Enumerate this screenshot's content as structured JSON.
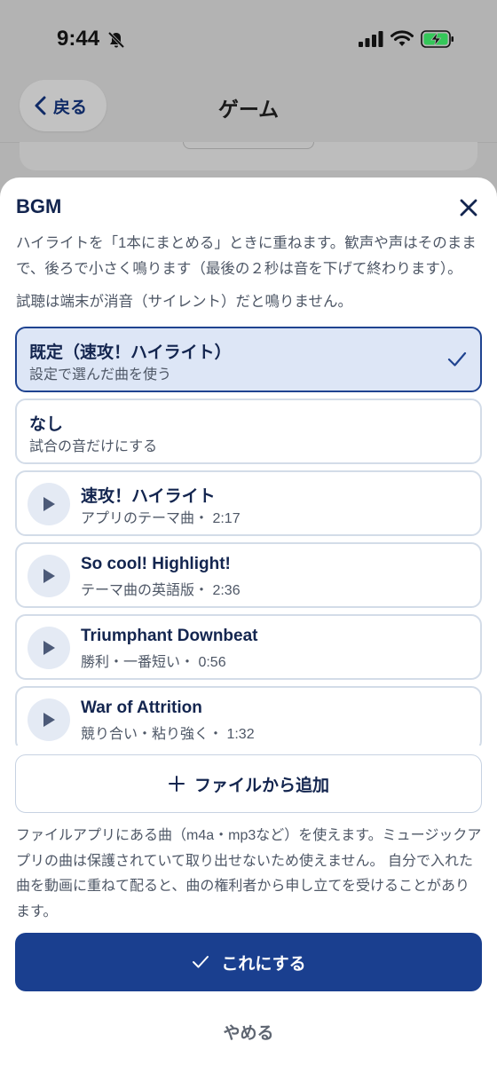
{
  "status_bar": {
    "time": "9:44"
  },
  "nav": {
    "back_label": "戻る",
    "title": "ゲーム"
  },
  "sheet": {
    "title": "BGM",
    "description": "ハイライトを「1本にまとめる」ときに重ねます。歓声や声はそのままで、後ろで小さく鳴ります（最後の２秒は音を下げて終わります）。",
    "note": "試聴は端末が消音（サイレント）だと鳴りません。",
    "options": [
      {
        "title": "既定（速攻！ハイライト）",
        "subtitle": "設定で選んだ曲を使う",
        "selected": true
      },
      {
        "title": "なし",
        "subtitle": "試合の音だけにする",
        "selected": false
      },
      {
        "title": "速攻！ハイライト",
        "subtitle": "アプリのテーマ曲・ 2:17",
        "selected": false
      },
      {
        "title": "So cool! Highlight!",
        "subtitle": "テーマ曲の英語版・ 2:36",
        "selected": false
      },
      {
        "title": "Triumphant Downbeat",
        "subtitle": "勝利・一番短い・ 0:56",
        "selected": false
      },
      {
        "title": "War of Attrition",
        "subtitle": "競り合い・粘り強く・ 1:32",
        "selected": false
      }
    ],
    "add_file_label": "ファイルから追加",
    "footnote": "ファイルアプリにある曲（m4a・mp3など）を使えます。ミュージックアプリの曲は保護されていて取り出せないため使えません。 自分で入れた曲を動画に重ねて配ると、曲の権利者から申し立てを受けることがあります。",
    "confirm_label": "これにする",
    "cancel_label": "やめる"
  },
  "colors": {
    "accent": "#1a3f8f",
    "selected_bg": "#dde6f6",
    "text_dark": "#13254f",
    "text_muted": "#4e5766",
    "battery_green": "#34c759"
  }
}
